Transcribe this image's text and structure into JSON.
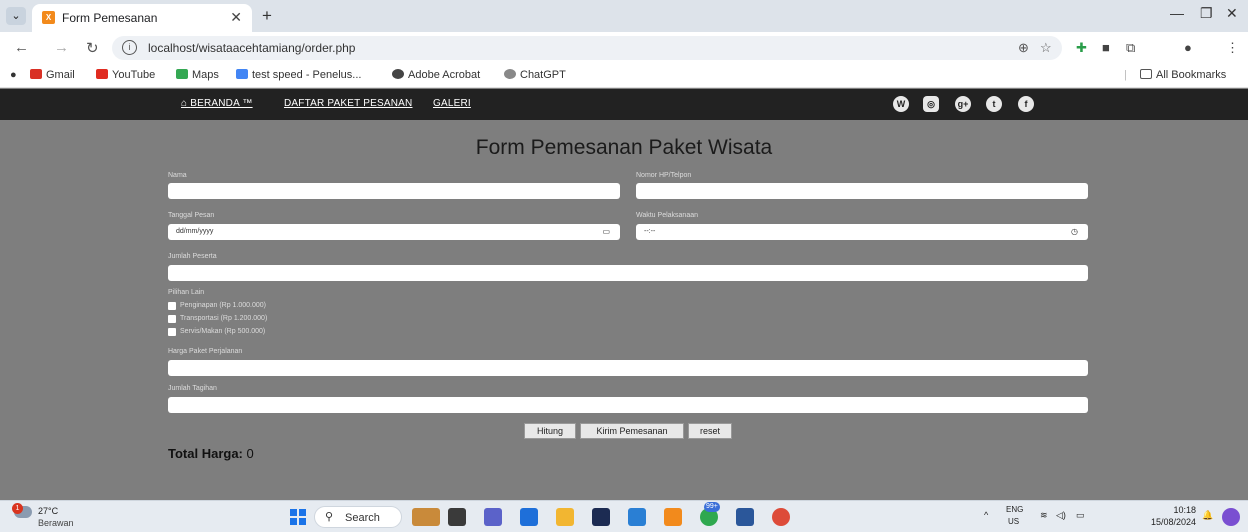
{
  "browser": {
    "tab_title": "Form Pemesanan",
    "url": "localhost/wisataacehtamiang/order.php",
    "bookmarks": [
      "Gmail",
      "YouTube",
      "Maps",
      "test speed - Penelus...",
      "Adobe Acrobat",
      "ChatGPT"
    ],
    "all_bookmarks": "All Bookmarks"
  },
  "nav": {
    "home": "BERANDA ™",
    "packages": "DAFTAR PAKET PESANAN",
    "gallery": "GALERI",
    "social_icons": [
      "wordpress-icon",
      "instagram-icon",
      "google-plus-icon",
      "twitter-icon",
      "facebook-icon"
    ]
  },
  "form": {
    "title": "Form Pemesanan Paket Wisata",
    "name_label": "Nama",
    "phone_label": "Nomor HP/Telpon",
    "order_date_label": "Tanggal Pesan",
    "order_date_placeholder": "dd/mm/yyyy",
    "exec_time_label": "Waktu Pelaksanaan",
    "exec_time_placeholder": "--:--",
    "participants_label": "Jumlah Peserta",
    "other_options_label": "Pilihan Lain",
    "options": [
      "Penginapan (Rp 1.000.000)",
      "Transportasi (Rp 1.200.000)",
      "Servis/Makan (Rp 500.000)"
    ],
    "package_price_label": "Harga Paket Perjalanan",
    "bill_label": "Jumlah Tagihan",
    "btn_calculate": "Hitung",
    "btn_submit": "Kirim Pemesanan",
    "btn_reset": "reset",
    "total_label": "Total Harga:",
    "total_value": "0"
  },
  "taskbar": {
    "temperature": "27°C",
    "weather": "Berawan",
    "search": "Search",
    "notification_badge": "1",
    "app_badge": "99+",
    "lang": "ENG",
    "region": "US",
    "time": "10:18",
    "date": "15/08/2024"
  }
}
